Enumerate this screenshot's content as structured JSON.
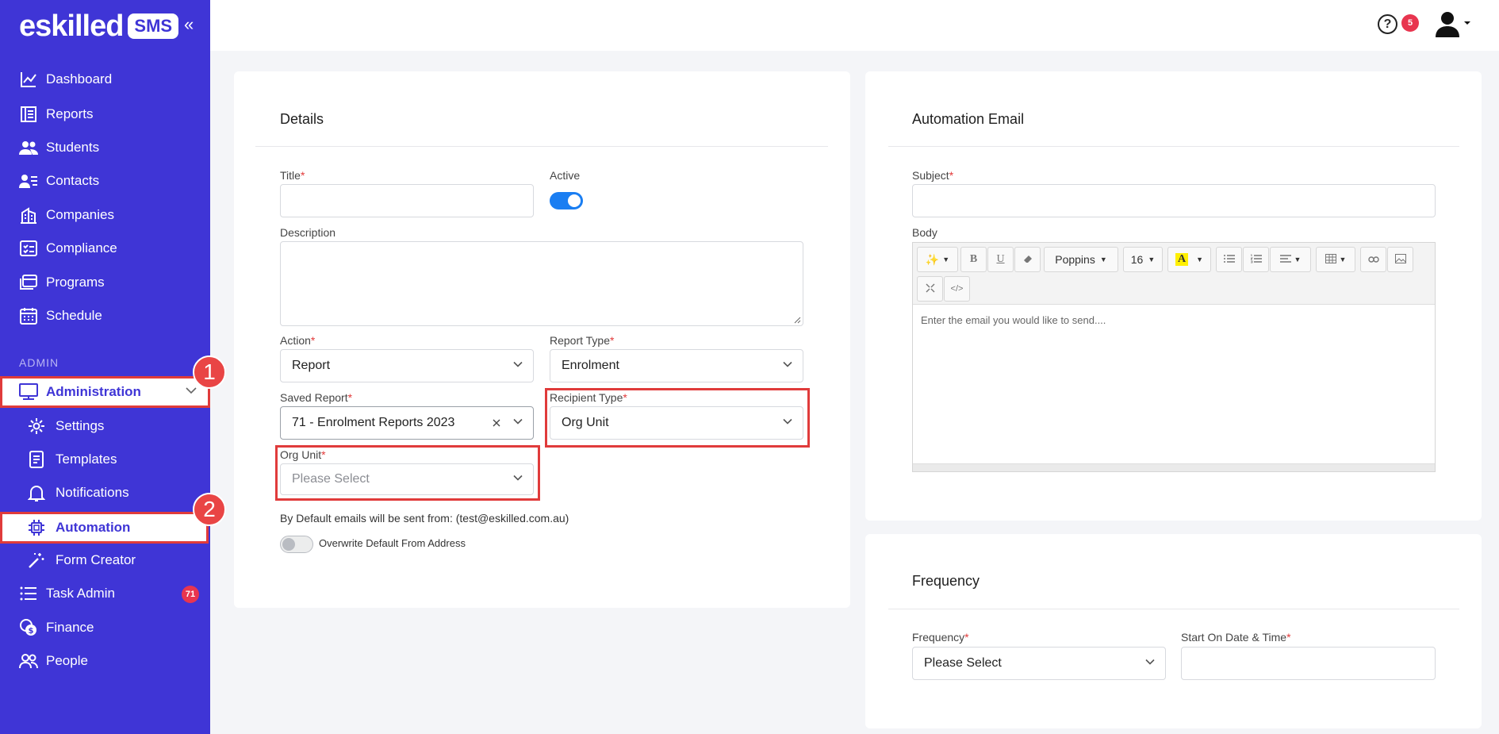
{
  "brand": {
    "name": "eskilled",
    "badge": "SMS"
  },
  "sidebar": {
    "items": [
      {
        "label": "Dashboard",
        "icon": "chart-line-icon"
      },
      {
        "label": "Reports",
        "icon": "report-icon"
      },
      {
        "label": "Students",
        "icon": "students-icon"
      },
      {
        "label": "Contacts",
        "icon": "contacts-icon"
      },
      {
        "label": "Companies",
        "icon": "building-icon"
      },
      {
        "label": "Compliance",
        "icon": "checklist-icon"
      },
      {
        "label": "Programs",
        "icon": "programs-icon"
      },
      {
        "label": "Schedule",
        "icon": "calendar-icon"
      }
    ],
    "section_label": "ADMIN",
    "admin": {
      "label": "Administration",
      "children": [
        "Settings",
        "Templates",
        "Notifications",
        "Automation",
        "Form Creator"
      ]
    },
    "bottom_items": [
      {
        "label": "Task Admin",
        "badge": "71"
      },
      {
        "label": "Finance"
      },
      {
        "label": "People"
      }
    ],
    "markers": [
      "1",
      "2"
    ]
  },
  "topbar": {
    "help_badge": "5",
    "help_symbol": "?"
  },
  "details": {
    "title": "Details",
    "title_label": "Title",
    "active_label": "Active",
    "description_label": "Description",
    "action_label": "Action",
    "action_value": "Report",
    "report_type_label": "Report Type",
    "report_type_value": "Enrolment",
    "saved_report_label": "Saved Report",
    "saved_report_value": "71 - Enrolment Reports 2023",
    "recipient_type_label": "Recipient Type",
    "recipient_type_value": "Org Unit",
    "org_unit_label": "Org Unit",
    "org_unit_placeholder": "Please Select",
    "default_note": "By Default emails will be sent from: (test@eskilled.com.au)",
    "overwrite_label": "Overwrite Default From Address"
  },
  "email": {
    "title": "Automation Email",
    "subject_label": "Subject",
    "body_label": "Body",
    "font_name": "Poppins",
    "font_size": "16",
    "body_placeholder": "Enter the email you would like to send...."
  },
  "frequency": {
    "title": "Frequency",
    "frequency_label": "Frequency",
    "frequency_value": "Please Select",
    "start_label": "Start On Date & Time"
  }
}
